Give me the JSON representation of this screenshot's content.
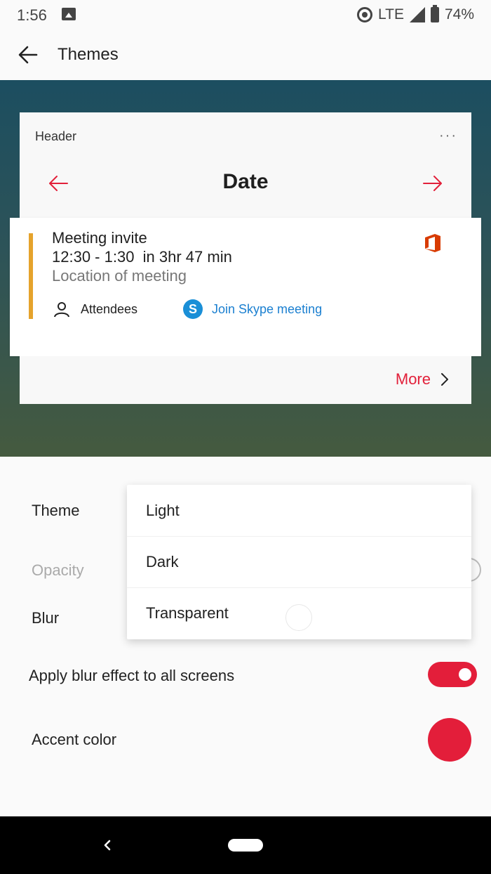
{
  "status_bar": {
    "time": "1:56",
    "network": "LTE",
    "battery": "74%",
    "icons": [
      "image-icon",
      "hotspot-icon",
      "signal-icon",
      "battery-icon"
    ]
  },
  "app_bar": {
    "title": "Themes",
    "back_icon": "arrow-left-icon"
  },
  "preview": {
    "header_label": "Header",
    "overflow": "···",
    "date_label": "Date",
    "event": {
      "title": "Meeting invite",
      "time": "12:30 - 1:30  in 3hr 47 min",
      "location": "Location of meeting",
      "attendees_label": "Attendees",
      "skype_letter": "S",
      "skype_link": "Join Skype meeting",
      "bar_color": "#e5a32c"
    },
    "more_label": "More",
    "accent_color": "#e2203a"
  },
  "settings": {
    "theme_label": "Theme",
    "opacity_label": "Opacity",
    "blur_label": "Blur",
    "apply_blur_label": "Apply blur effect to all screens",
    "apply_blur_on": true,
    "accent_label": "Accent color",
    "accent_color": "#e31e3a"
  },
  "theme_dropdown": {
    "options": [
      "Light",
      "Dark",
      "Transparent"
    ]
  },
  "nav_bar": {
    "icons": [
      "back-icon",
      "home-pill-icon"
    ]
  }
}
